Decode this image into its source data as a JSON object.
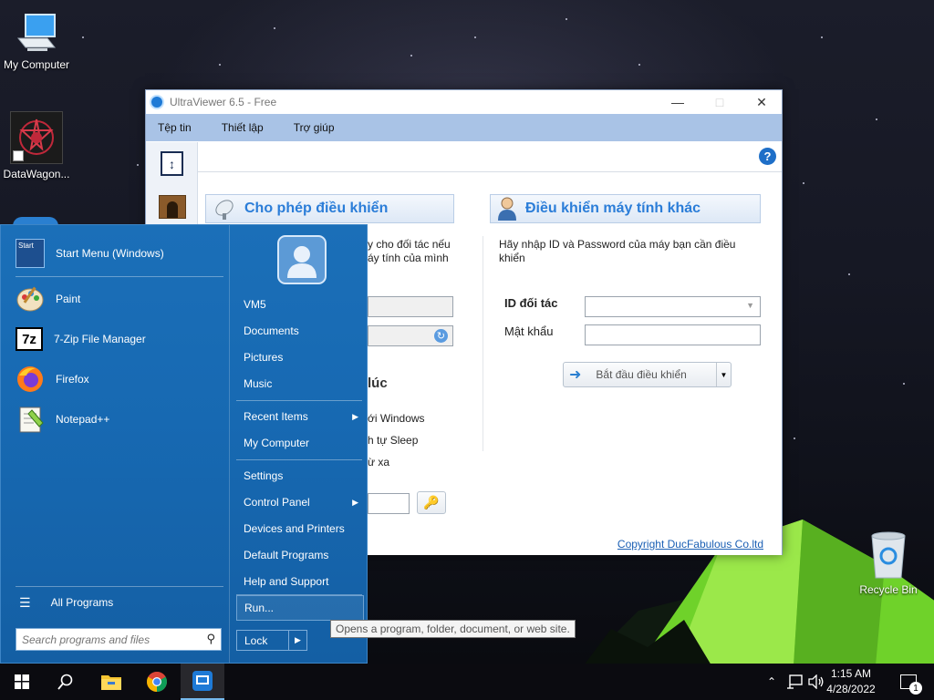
{
  "desktop": {
    "icons": [
      {
        "label": "My Computer",
        "icon": "computer-icon"
      },
      {
        "label": "DataWagon...",
        "icon": "datawagon-icon"
      },
      {
        "label": "Recycle Bin",
        "icon": "recycle-bin-icon"
      }
    ]
  },
  "ultraviewer": {
    "title": "UltraViewer 6.5 - Free",
    "menu": [
      "Tệp tin",
      "Thiết lập",
      "Trợ giúp"
    ],
    "allow_control": {
      "header": "Cho phép điều khiển",
      "desc_line1": "y cho đối tác nếu",
      "desc_line2": "áy tính của mình"
    },
    "partial": {
      "heading": "lúc",
      "opt1": "ới Windows",
      "opt2": "h tự Sleep",
      "opt3": "ừ xa"
    },
    "control_other": {
      "header": "Điều khiển máy tính khác",
      "desc": "Hãy nhập ID và Password của máy bạn cần điều khiển",
      "id_label": "ID đối tác",
      "id_value": "",
      "password_label": "Mật khẩu",
      "password_value": "",
      "start_button": "Bắt đầu điều khiển"
    },
    "copyright": "Copyright DucFabulous Co.ltd"
  },
  "start_menu": {
    "programs": [
      {
        "label": "Start Menu (Windows)",
        "icon": "start-menu-app-icon"
      },
      {
        "label": "Paint",
        "icon": "paint-icon"
      },
      {
        "label": "7-Zip File Manager",
        "icon": "7zip-icon"
      },
      {
        "label": "Firefox",
        "icon": "firefox-icon"
      },
      {
        "label": "Notepad++",
        "icon": "notepadpp-icon"
      }
    ],
    "all_programs": "All Programs",
    "search_placeholder": "Search programs and files",
    "right": [
      {
        "label": "VM5",
        "submenu": false
      },
      {
        "label": "Documents",
        "submenu": false
      },
      {
        "label": "Pictures",
        "submenu": false
      },
      {
        "label": "Music",
        "submenu": false
      },
      {
        "label": "Recent Items",
        "submenu": true
      },
      {
        "label": "My Computer",
        "submenu": false
      },
      {
        "label": "Settings",
        "submenu": false
      },
      {
        "label": "Control Panel",
        "submenu": true
      },
      {
        "label": "Devices and Printers",
        "submenu": false
      },
      {
        "label": "Default Programs",
        "submenu": false
      },
      {
        "label": "Help and Support",
        "submenu": false
      },
      {
        "label": "Run...",
        "submenu": false
      }
    ],
    "lock": "Lock",
    "tooltip": "Opens a program, folder, document, or web site."
  },
  "taskbar": {
    "time": "1:15 AM",
    "date": "4/28/2022",
    "notification_count": "1"
  },
  "colors": {
    "start_menu_bg": "#1769b2",
    "uv_menubar": "#a9c3e6",
    "uv_accent": "#2b7dd8",
    "taskbar": "#0b0b10"
  }
}
